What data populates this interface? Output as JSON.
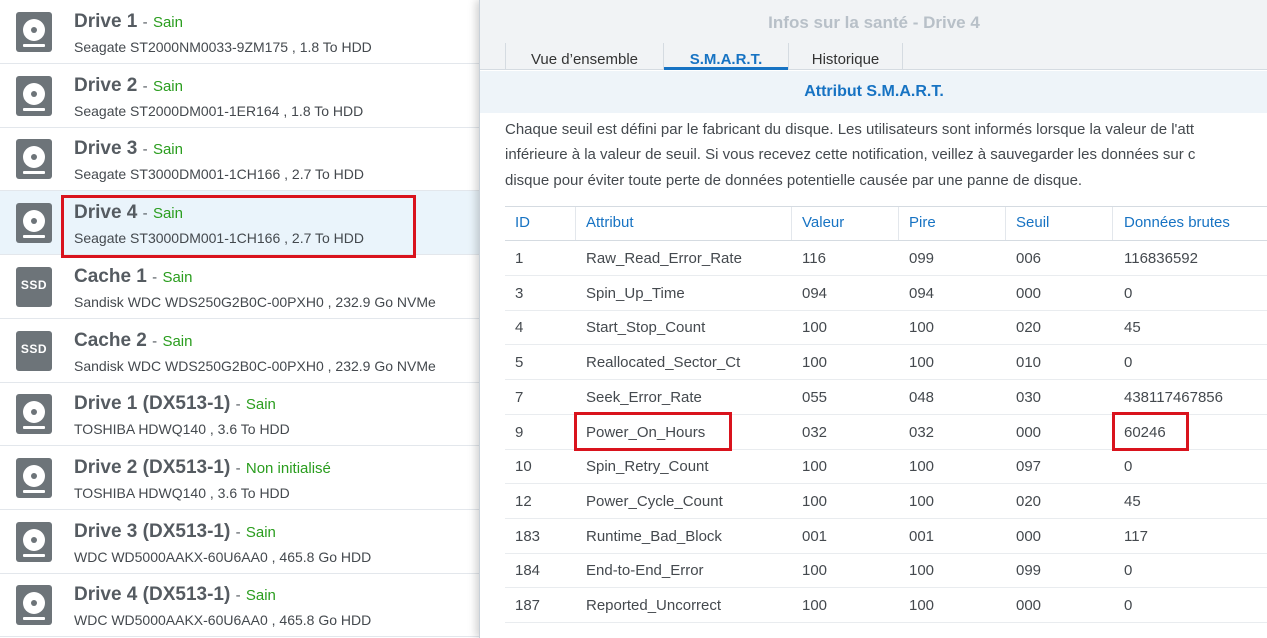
{
  "drives": [
    {
      "name": "Drive 1",
      "status": "Sain",
      "desc": "Seagate ST2000NM0033-9ZM175 , 1.8 To HDD",
      "type": "hdd-icon"
    },
    {
      "name": "Drive 2",
      "status": "Sain",
      "desc": "Seagate ST2000DM001-1ER164 , 1.8 To HDD",
      "type": "hdd-icon"
    },
    {
      "name": "Drive 3",
      "status": "Sain",
      "desc": "Seagate ST3000DM001-1CH166 , 2.7 To HDD",
      "type": "hdd-icon"
    },
    {
      "name": "Drive 4",
      "status": "Sain",
      "desc": "Seagate ST3000DM001-1CH166 , 2.7 To HDD",
      "type": "hdd-icon"
    },
    {
      "name": "Cache 1",
      "status": "Sain",
      "desc": "Sandisk WDC WDS250G2B0C-00PXH0 , 232.9 Go NVMe",
      "type": "ssd-icon",
      "badge": "SSD"
    },
    {
      "name": "Cache 2",
      "status": "Sain",
      "desc": "Sandisk WDC WDS250G2B0C-00PXH0 , 232.9 Go NVMe",
      "type": "ssd-icon",
      "badge": "SSD"
    },
    {
      "name": "Drive 1 (DX513-1)",
      "status": "Sain",
      "desc": "TOSHIBA HDWQ140 , 3.6 To HDD",
      "type": "hdd-icon"
    },
    {
      "name": "Drive 2 (DX513-1)",
      "status": "Non initialisé",
      "desc": "TOSHIBA HDWQ140 , 3.6 To HDD",
      "type": "hdd-icon"
    },
    {
      "name": "Drive 3 (DX513-1)",
      "status": "Sain",
      "desc": "WDC WD5000AAKX-60U6AA0 , 465.8 Go HDD",
      "type": "hdd-icon"
    },
    {
      "name": "Drive 4 (DX513-1)",
      "status": "Sain",
      "desc": "WDC WD5000AAKX-60U6AA0 , 465.8 Go HDD",
      "type": "hdd-icon"
    }
  ],
  "separator": "-",
  "selected_drive_index": 3,
  "dialog": {
    "title": "Infos sur la santé - Drive 4",
    "tabs": [
      "Vue d’ensemble",
      "S.M.A.R.T.",
      "Historique"
    ],
    "active_tab": 1,
    "section_title": "Attribut S.M.A.R.T.",
    "description_lines": [
      "Chaque seuil est défini par le fabricant du disque. Les utilisateurs sont informés lorsque la valeur de l'att",
      "inférieure à la valeur de seuil. Si vous recevez cette notification, veillez à sauvegarder les données sur c",
      "disque pour éviter toute perte de données potentielle causée par une panne de disque."
    ],
    "columns": [
      "ID",
      "Attribut",
      "Valeur",
      "Pire",
      "Seuil",
      "Données brutes"
    ],
    "rows": [
      [
        "1",
        "Raw_Read_Error_Rate",
        "116",
        "099",
        "006",
        "116836592"
      ],
      [
        "3",
        "Spin_Up_Time",
        "094",
        "094",
        "000",
        "0"
      ],
      [
        "4",
        "Start_Stop_Count",
        "100",
        "100",
        "020",
        "45"
      ],
      [
        "5",
        "Reallocated_Sector_Ct",
        "100",
        "100",
        "010",
        "0"
      ],
      [
        "7",
        "Seek_Error_Rate",
        "055",
        "048",
        "030",
        "438117467856"
      ],
      [
        "9",
        "Power_On_Hours",
        "032",
        "032",
        "000",
        "60246"
      ],
      [
        "10",
        "Spin_Retry_Count",
        "100",
        "100",
        "097",
        "0"
      ],
      [
        "12",
        "Power_Cycle_Count",
        "100",
        "100",
        "020",
        "45"
      ],
      [
        "183",
        "Runtime_Bad_Block",
        "001",
        "001",
        "000",
        "117"
      ],
      [
        "184",
        "End-to-End_Error",
        "100",
        "100",
        "099",
        "0"
      ],
      [
        "187",
        "Reported_Uncorrect",
        "100",
        "100",
        "000",
        "0"
      ]
    ]
  },
  "colors": {
    "status_ok": "#2a9d1e",
    "accent": "#1773c3",
    "highlight": "#d9131d"
  }
}
